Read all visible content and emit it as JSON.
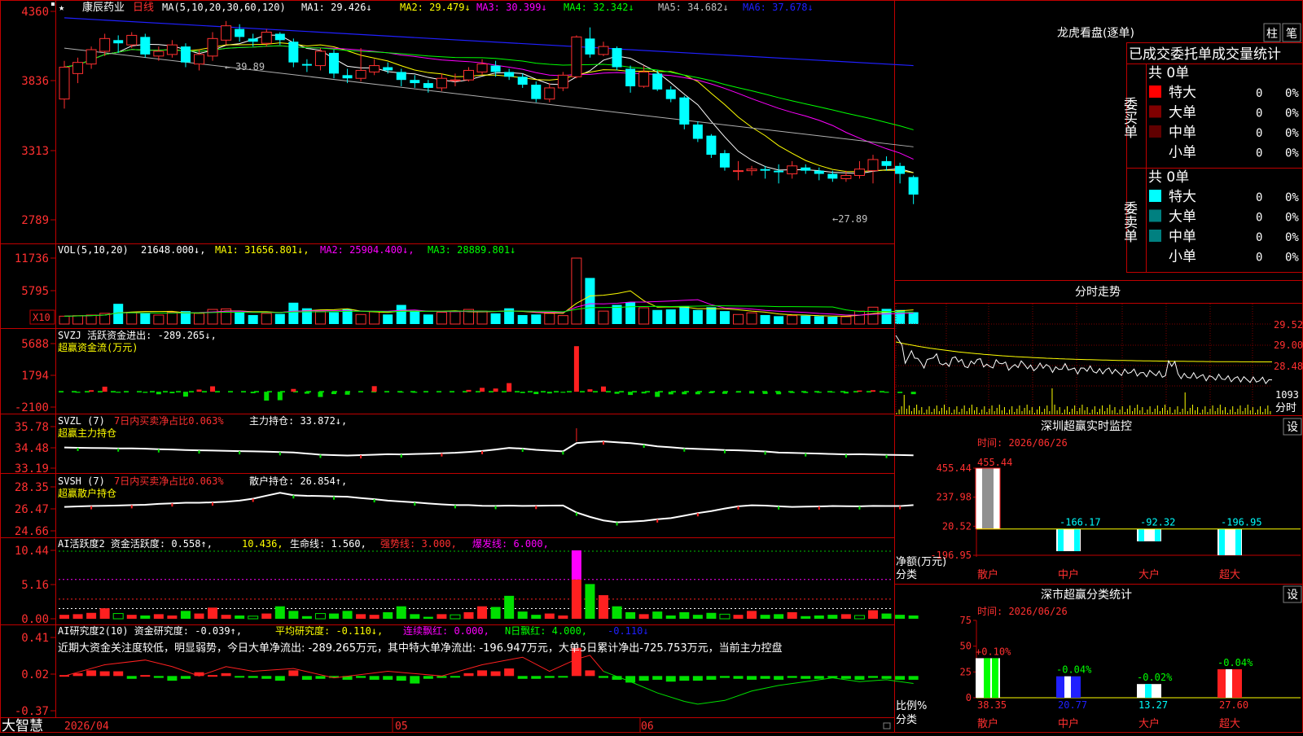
{
  "stock": {
    "name": "康辰药业",
    "period": "日线",
    "app": "大智慧"
  },
  "main_panel": {
    "ma_header": "MA(5,10,20,30,60,120)",
    "ma": [
      {
        "label": "MA1: 29.426↓",
        "color": "#ffffff"
      },
      {
        "label": "MA2: 29.479↓",
        "color": "#ffff00"
      },
      {
        "label": "MA3: 30.399↓",
        "color": "#ff00ff"
      },
      {
        "label": "MA4: 32.342↓",
        "color": "#00ff00"
      },
      {
        "label": "MA5: 34.682↓",
        "color": "#c0c0c0"
      },
      {
        "label": "MA6: 37.678↓",
        "color": "#2020ff"
      }
    ],
    "y_ticks": [
      "4360",
      "3836",
      "3313",
      "2789"
    ],
    "high_label": "39.89",
    "low_label": "←27.89"
  },
  "vol_panel": {
    "header": "VOL(5,10,20)",
    "value": "21648.000↓,",
    "ma1": "MA1: 31656.801↓,",
    "ma2": "MA2: 25904.400↓,",
    "ma3": "MA3: 28889.801↓",
    "y_ticks": [
      "11736",
      "5795"
    ],
    "unit": "X10"
  },
  "svzj_panel": {
    "line1": "SVZJ  活跃资金进出: -289.265↓,",
    "line2": "超赢资金流(万元)",
    "y_ticks": [
      "5688",
      "1794",
      "-2100"
    ]
  },
  "svzl_panel": {
    "title": "SVZL (7)",
    "red": "7日内买卖净占比0.063%",
    "val": "主力持仓: 33.872↓,",
    "line2": "超赢主力持仓",
    "y_ticks": [
      "35.78",
      "34.48",
      "33.19"
    ]
  },
  "svsh_panel": {
    "title": "SVSH (7)",
    "red": "7日内买卖净占比0.063%",
    "val": "散户持仓: 26.854↑,",
    "line2": "超赢散户持仓",
    "y_ticks": [
      "28.35",
      "26.47",
      "24.66"
    ]
  },
  "ai2_panel": {
    "title": "AI活跃度2 资金活跃度: 0.558↑,",
    "v2": "10.436,",
    "life": "生命线: 1.560,",
    "strong": "强势线: 3.000,",
    "burst": "爆发线: 6.000,",
    "y_ticks": [
      "10.44",
      "5.16",
      "0.00"
    ]
  },
  "ai_research_panel": {
    "title": "AI研究度2(10) 资金研究度: -0.039↑,",
    "avg": "平均研究度: -0.110↓,",
    "red_cont": "连续飘红: 0.000,",
    "n_red": "N日飘红: 4.000,",
    "tail": "-0.110↓",
    "comment": "近期大资金关注度较低，明显弱势，今日大单净流出: -289.265万元，其中特大单净流出: -196.947万元，大单5日累计净出-725.753万元，当前主力控盘",
    "y_ticks": [
      "0.41",
      "0.02",
      "-0.37"
    ]
  },
  "x_axis": {
    "labels": [
      "2026/04",
      "05",
      "06"
    ]
  },
  "right_panel": {
    "lhb": {
      "title": "龙虎看盘(逐单)",
      "btn1": "柱",
      "btn2": "笔",
      "header": "已成交委托单成交量统计",
      "buy_label": "委买单",
      "sell_label": "委卖单",
      "total": "共 0单",
      "rows": [
        "特大",
        "大单",
        "中单",
        "小单"
      ],
      "val": "0",
      "pct": "0%",
      "buy_colors": [
        "#ff0000",
        "#800000",
        "#600000",
        "#000000"
      ],
      "sell_colors": [
        "#00ffff",
        "#008080",
        "#008080",
        "#000000"
      ]
    },
    "intraday": {
      "title": "分时走势",
      "y_ticks": [
        "29.52",
        "29.00",
        "28.48"
      ],
      "vol_tick": "1093",
      "vol_label": "分时"
    },
    "monitor": {
      "title": "深圳超赢实时监控",
      "set": "设",
      "time": "时间: 2026/06/26",
      "y_ticks": [
        "455.44",
        "237.98",
        "20.52",
        "-196.95"
      ],
      "ylabel": "净额(万元)",
      "xlabel": "分类",
      "categories": [
        "散户",
        "中户",
        "大户",
        "超大"
      ]
    },
    "classify": {
      "title": "深市超赢分类统计",
      "set": "设",
      "time": "时间: 2026/06/26",
      "y_ticks": [
        "75",
        "50",
        "25",
        "0"
      ],
      "ylabel": "比例%",
      "xlabel": "分类",
      "categories": [
        "散户",
        "中户",
        "大户",
        "超大"
      ]
    }
  },
  "chart_data": [
    {
      "type": "candlestick",
      "title": "康辰药业 日线",
      "ylim": [
        27.0,
        40.5
      ],
      "candles": [
        [
          35.2,
          37.2,
          34.6,
          37.6
        ],
        [
          36.8,
          37.5,
          36.2,
          37.8
        ],
        [
          37.4,
          38.3,
          37.1,
          38.5
        ],
        [
          38.2,
          39.0,
          37.9,
          39.3
        ],
        [
          38.9,
          38.7,
          38.1,
          39.2
        ],
        [
          38.6,
          39.2,
          38.4,
          39.4
        ],
        [
          39.1,
          38.0,
          37.8,
          39.3
        ],
        [
          37.9,
          38.2,
          37.6,
          38.5
        ],
        [
          38.0,
          38.6,
          37.8,
          38.9
        ],
        [
          38.5,
          37.5,
          37.2,
          38.7
        ],
        [
          37.4,
          38.0,
          37.0,
          38.3
        ],
        [
          37.9,
          39.0,
          37.6,
          39.4
        ],
        [
          38.9,
          39.8,
          38.6,
          40.1
        ],
        [
          39.6,
          39.1,
          38.8,
          39.9
        ],
        [
          39.0,
          38.8,
          38.5,
          39.3
        ],
        [
          38.7,
          39.4,
          38.5,
          39.6
        ],
        [
          39.3,
          38.9,
          38.6,
          39.4
        ],
        [
          38.8,
          37.5,
          37.2,
          39.0
        ],
        [
          37.4,
          37.3,
          36.9,
          37.7
        ],
        [
          37.3,
          38.2,
          37.0,
          38.4
        ],
        [
          38.1,
          36.8,
          36.5,
          38.3
        ],
        [
          36.7,
          36.5,
          36.2,
          37.1
        ],
        [
          36.5,
          37.0,
          36.3,
          38.4
        ],
        [
          36.9,
          37.3,
          36.7,
          37.7
        ],
        [
          37.2,
          37.0,
          36.8,
          37.5
        ],
        [
          36.9,
          36.4,
          36.0,
          37.1
        ],
        [
          36.4,
          36.2,
          35.9,
          36.7
        ],
        [
          36.2,
          35.9,
          35.6,
          36.4
        ],
        [
          35.9,
          36.5,
          35.7,
          36.8
        ],
        [
          36.4,
          36.4,
          36.0,
          36.8
        ],
        [
          36.4,
          37.0,
          36.3,
          37.2
        ],
        [
          36.9,
          37.4,
          36.7,
          37.7
        ],
        [
          37.3,
          36.9,
          36.6,
          37.6
        ],
        [
          36.9,
          36.6,
          36.4,
          37.1
        ],
        [
          36.6,
          36.1,
          35.9,
          36.8
        ],
        [
          36.1,
          35.2,
          35.0,
          36.3
        ],
        [
          35.2,
          35.9,
          35.0,
          36.2
        ],
        [
          35.9,
          36.7,
          35.7,
          36.9
        ],
        [
          36.6,
          39.1,
          36.5,
          39.2
        ],
        [
          39.0,
          38.0,
          37.8,
          39.7
        ],
        [
          38.0,
          38.5,
          37.9,
          38.8
        ],
        [
          38.4,
          37.2,
          37.0,
          38.5
        ],
        [
          37.1,
          36.0,
          35.6,
          37.3
        ],
        [
          36.0,
          36.9,
          35.9,
          37.3
        ],
        [
          36.8,
          35.8,
          35.7,
          37.0
        ],
        [
          35.8,
          35.2,
          35.0,
          36.0
        ],
        [
          35.3,
          33.6,
          33.3,
          35.4
        ],
        [
          33.6,
          32.7,
          32.5,
          33.8
        ],
        [
          32.9,
          31.7,
          31.5,
          33.0
        ],
        [
          31.8,
          30.9,
          30.7,
          32.0
        ],
        [
          30.7,
          30.7,
          30.1,
          31.3
        ],
        [
          30.7,
          30.8,
          30.4,
          31.0
        ],
        [
          30.8,
          30.7,
          30.2,
          31.0
        ],
        [
          30.7,
          30.6,
          29.9,
          31.1
        ],
        [
          30.5,
          31.0,
          30.2,
          31.3
        ],
        [
          30.9,
          30.7,
          30.5,
          31.1
        ],
        [
          30.7,
          30.5,
          30.1,
          30.9
        ],
        [
          30.5,
          30.2,
          30.0,
          30.7
        ],
        [
          30.2,
          30.4,
          30.0,
          30.7
        ],
        [
          30.4,
          30.8,
          30.2,
          31.3
        ],
        [
          30.7,
          31.4,
          29.9,
          31.7
        ],
        [
          31.3,
          31.0,
          30.7,
          31.6
        ],
        [
          31.0,
          30.5,
          29.9,
          31.2
        ],
        [
          30.3,
          29.2,
          28.6,
          30.4
        ]
      ]
    },
    {
      "type": "bar",
      "title": "VOL(5,10,20)",
      "ylim": [
        0,
        11736
      ],
      "values": [
        1400,
        1500,
        1600,
        1900,
        3600,
        2100,
        1900,
        1600,
        2100,
        2300,
        1900,
        2600,
        2700,
        2200,
        1600,
        1900,
        1800,
        3800,
        2800,
        2300,
        2100,
        2600,
        1700,
        2200,
        1700,
        3400,
        2400,
        1700,
        2100,
        2200,
        2600,
        2300,
        1900,
        2800,
        1600,
        1700,
        1900,
        1500,
        11736,
        8200,
        2300,
        3400,
        3900,
        2900,
        2500,
        2600,
        3200,
        2500,
        3000,
        2300,
        1700,
        2000,
        1600,
        1400,
        1500,
        1500,
        1400,
        1300,
        1300,
        2300,
        3000,
        2700,
        2500,
        2100
      ]
    },
    {
      "type": "bar",
      "title": "SVZJ 活跃资金进出",
      "ylim": [
        -2100,
        5688
      ],
      "values": [
        0,
        -120,
        180,
        600,
        -120,
        0,
        -130,
        -300,
        -180,
        -580,
        260,
        640,
        0,
        0,
        -180,
        -1050,
        -1000,
        330,
        -230,
        -620,
        -280,
        -350,
        0,
        660,
        0,
        -100,
        -120,
        0,
        0,
        0,
        220,
        460,
        380,
        1020,
        -160,
        -280,
        -200,
        -120,
        5380,
        290,
        620,
        -240,
        -380,
        -200,
        -610,
        -310,
        -300,
        -300,
        -180,
        -250,
        -100,
        -210,
        -260,
        -300,
        -150,
        -150,
        -130,
        -100,
        -200,
        150,
        180,
        -120,
        -160,
        -289
      ]
    },
    {
      "type": "line",
      "title": "SVZL 主力持仓",
      "ylim": [
        33.19,
        35.78
      ],
      "values": [
        34.48,
        34.46,
        34.45,
        34.44,
        34.42,
        34.42,
        34.4,
        34.37,
        34.35,
        34.32,
        34.3,
        34.29,
        34.27,
        34.25,
        34.24,
        34.22,
        34.19,
        34.17,
        34.1,
        34.03,
        34.0,
        33.98,
        34.0,
        34.03,
        34.06,
        34.05,
        34.07,
        34.09,
        34.12,
        34.15,
        34.2,
        34.26,
        34.35,
        34.45,
        34.41,
        34.33,
        34.28,
        34.24,
        34.75,
        34.82,
        34.86,
        34.8,
        34.75,
        34.66,
        34.55,
        34.49,
        34.42,
        34.39,
        34.36,
        34.32,
        34.3,
        34.27,
        34.23,
        34.16,
        34.14,
        34.12,
        34.1,
        34.07,
        34.05,
        34.06,
        34.04,
        34.02,
        34.01,
        33.99
      ]
    },
    {
      "type": "line",
      "title": "SVSH 散户持仓",
      "ylim": [
        24.66,
        28.35
      ],
      "values": [
        26.67,
        26.71,
        26.74,
        26.76,
        26.79,
        26.82,
        26.85,
        26.92,
        26.97,
        27.02,
        27.02,
        27.05,
        27.1,
        27.2,
        27.36,
        27.61,
        27.85,
        27.65,
        27.6,
        27.58,
        27.55,
        27.52,
        27.41,
        27.32,
        27.2,
        27.12,
        27.05,
        26.96,
        26.88,
        26.82,
        26.82,
        26.76,
        26.75,
        26.78,
        26.75,
        26.76,
        26.78,
        26.79,
        26.2,
        25.83,
        25.53,
        25.38,
        25.43,
        25.5,
        25.63,
        25.73,
        25.93,
        26.15,
        26.32,
        26.53,
        26.72,
        26.8,
        26.78,
        26.72,
        26.67,
        26.69,
        26.71,
        26.74,
        26.73,
        26.72,
        26.75,
        26.74,
        26.74,
        26.82
      ]
    },
    {
      "type": "bar",
      "title": "AI活跃度2",
      "ylim": [
        0,
        10.44
      ],
      "values": [
        0.6,
        0.7,
        0.9,
        1.6,
        0.8,
        0.6,
        0.5,
        0.7,
        0.5,
        1.2,
        0.8,
        1.7,
        0.6,
        0.5,
        0.4,
        0.8,
        1.9,
        1.2,
        0.4,
        0.8,
        0.8,
        1.2,
        0.7,
        0.6,
        1.0,
        1.9,
        0.7,
        0.3,
        0.7,
        0.6,
        1.0,
        1.9,
        1.8,
        3.5,
        1.1,
        0.6,
        0.8,
        0.5,
        10.44,
        5.3,
        3.6,
        1.9,
        1.0,
        0.7,
        1.1,
        0.5,
        1.0,
        0.6,
        0.9,
        0.7,
        0.6,
        1.2,
        0.6,
        0.7,
        1.0,
        0.4,
        0.5,
        0.6,
        0.7,
        0.5,
        1.3,
        0.8,
        0.6,
        0.5
      ]
    },
    {
      "type": "bar",
      "title": "AI研究度2(10)",
      "ylim": [
        -0.37,
        0.41
      ],
      "values": [
        0.01,
        0.03,
        0.06,
        0.05,
        0.05,
        -0.03,
        0.01,
        -0.02,
        -0.05,
        -0.03,
        0.04,
        0.01,
        0.03,
        -0.01,
        -0.02,
        -0.03,
        -0.05,
        0.06,
        -0.04,
        -0.03,
        -0.02,
        -0.04,
        -0.02,
        -0.04,
        -0.04,
        -0.05,
        -0.08,
        -0.03,
        -0.02,
        -0.01,
        0.03,
        0.06,
        0.05,
        0.08,
        -0.03,
        -0.03,
        -0.02,
        -0.01,
        0.3,
        0.06,
        -0.02,
        -0.04,
        -0.07,
        -0.05,
        -0.04,
        -0.06,
        -0.05,
        -0.05,
        -0.04,
        -0.02,
        -0.03,
        -0.04,
        -0.03,
        -0.04,
        -0.02,
        -0.03,
        -0.03,
        -0.02,
        -0.03,
        -0.04,
        -0.02,
        -0.03,
        -0.04,
        -0.04
      ]
    },
    {
      "type": "bar",
      "title": "深圳超赢实时监控",
      "categories": [
        "散户",
        "中户",
        "大户",
        "超大"
      ],
      "values": [
        455.44,
        -166.17,
        -92.32,
        -196.95
      ],
      "ylim": [
        -196.95,
        455.44
      ]
    },
    {
      "type": "bar",
      "title": "深市超赢分类统计",
      "categories": [
        "散户",
        "中户",
        "大户",
        "超大"
      ],
      "values": [
        38.35,
        20.77,
        13.27,
        27.6
      ],
      "changes": [
        "+0.10%",
        "-0.04%",
        "-0.02%",
        "-0.04%"
      ],
      "ylim": [
        0,
        75
      ]
    }
  ]
}
